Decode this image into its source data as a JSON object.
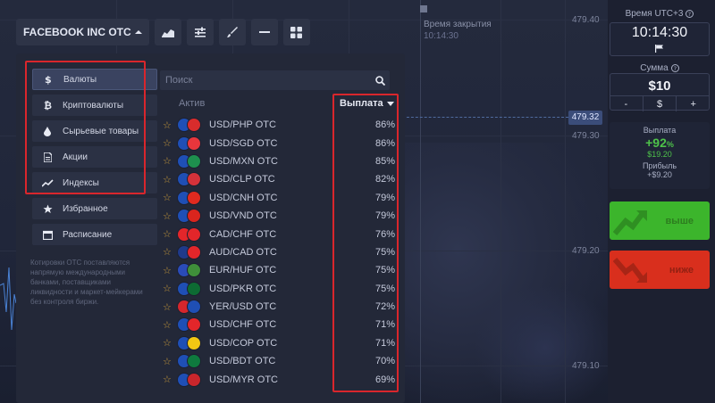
{
  "toolbar": {
    "asset_label": "FACEBOOK INC OTC",
    "tools": [
      {
        "name": "chart-type-icon"
      },
      {
        "name": "indicators-icon"
      },
      {
        "name": "drawing-brush-icon"
      },
      {
        "name": "line-tool-icon"
      },
      {
        "name": "layout-grid-icon"
      }
    ]
  },
  "chart": {
    "close_time_label": "Время закрытия",
    "close_time_value": "10:14:30",
    "price_ticks": [
      "479.40",
      "479.30",
      "479.20",
      "479.10"
    ],
    "current_price": "479.32"
  },
  "panel": {
    "categories": [
      {
        "label": "Валюты",
        "icon": "dollar-icon",
        "active": true
      },
      {
        "label": "Криптовалюты",
        "icon": "bitcoin-icon",
        "active": false
      },
      {
        "label": "Сырьевые товары",
        "icon": "drop-icon",
        "active": false
      },
      {
        "label": "Акции",
        "icon": "document-icon",
        "active": false
      },
      {
        "label": "Индексы",
        "icon": "trend-icon",
        "active": false
      },
      {
        "label": "Избранное",
        "icon": "star-icon",
        "active": false
      },
      {
        "label": "Расписание",
        "icon": "calendar-icon",
        "active": false
      }
    ],
    "note": "Котировки OTC поставляются напрямую международными банками, поставщиками ликвидности и маркет-мейкерами без контроля биржи.",
    "search_placeholder": "Поиск",
    "col_asset": "Актив",
    "col_payout": "Выплата",
    "assets": [
      {
        "name": "USD/PHP OTC",
        "payout": "86%",
        "flags": [
          "#1f4fb5",
          "#d92c2c"
        ]
      },
      {
        "name": "USD/SGD OTC",
        "payout": "86%",
        "flags": [
          "#1f4fb5",
          "#e8363c"
        ]
      },
      {
        "name": "USD/MXN OTC",
        "payout": "85%",
        "flags": [
          "#1f4fb5",
          "#1e8f4e"
        ]
      },
      {
        "name": "USD/CLP OTC",
        "payout": "82%",
        "flags": [
          "#1f4fb5",
          "#d5323a"
        ]
      },
      {
        "name": "USD/CNH OTC",
        "payout": "79%",
        "flags": [
          "#1f4fb5",
          "#e02a1f"
        ]
      },
      {
        "name": "USD/VND OTC",
        "payout": "79%",
        "flags": [
          "#1f4fb5",
          "#da251d"
        ]
      },
      {
        "name": "CAD/CHF OTC",
        "payout": "76%",
        "flags": [
          "#e3262a",
          "#e3262a"
        ]
      },
      {
        "name": "AUD/CAD OTC",
        "payout": "75%",
        "flags": [
          "#1f3a8a",
          "#e3262a"
        ]
      },
      {
        "name": "EUR/HUF OTC",
        "payout": "75%",
        "flags": [
          "#2a4bb8",
          "#3f8f3a"
        ]
      },
      {
        "name": "USD/PKR OTC",
        "payout": "75%",
        "flags": [
          "#1f4fb5",
          "#0d6b33"
        ]
      },
      {
        "name": "YER/USD OTC",
        "payout": "72%",
        "flags": [
          "#d5262c",
          "#1f4fb5"
        ]
      },
      {
        "name": "USD/CHF OTC",
        "payout": "71%",
        "flags": [
          "#1f4fb5",
          "#e3262a"
        ]
      },
      {
        "name": "USD/COP OTC",
        "payout": "71%",
        "flags": [
          "#1f4fb5",
          "#f3c713"
        ]
      },
      {
        "name": "USD/BDT OTC",
        "payout": "70%",
        "flags": [
          "#1f4fb5",
          "#0f7a3e"
        ]
      },
      {
        "name": "USD/MYR OTC",
        "payout": "69%",
        "flags": [
          "#1f4fb5",
          "#c9262c"
        ]
      }
    ]
  },
  "right": {
    "time_label": "Время UTC+3",
    "time_value": "10:14:30",
    "amount_label": "Сумма",
    "amount_value": "$10",
    "step_minus": "-",
    "step_currency": "$",
    "step_plus": "+",
    "payout_label": "Выплата",
    "payout_pct": "+92",
    "payout_pct_sign": "%",
    "payout_usd": "$19.20",
    "profit_label": "Прибыль",
    "profit_value": "+$9.20",
    "up_label": "выше",
    "down_label": "ниже",
    "colors": {
      "up": "#3cb52c",
      "down": "#d92f1d",
      "accent_green": "#4ec24a",
      "highlight": "#d9262c"
    }
  }
}
